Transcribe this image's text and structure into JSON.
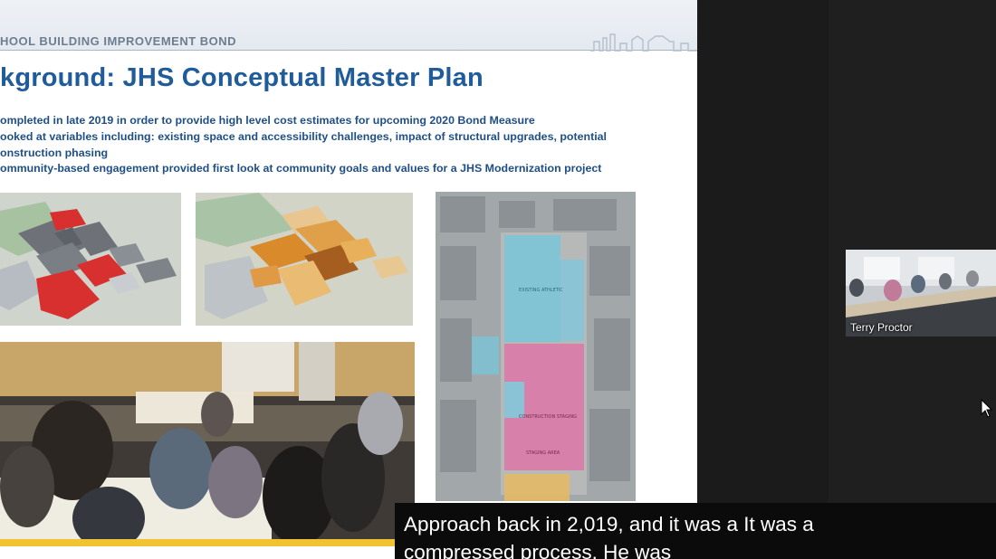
{
  "slide": {
    "band_title": "HOOL BUILDING IMPROVEMENT BOND",
    "title": "kground:  JHS Conceptual Master Plan",
    "bullets": [
      "ompleted in late 2019 in order to provide high level cost estimates for upcoming 2020 Bond Measure",
      "ooked at variables including:  existing space and accessibility challenges, impact of structural upgrades, potential",
      "onstruction phasing",
      "ommunity-based engagement provided first look at community goals and values for a JHS Modernization project"
    ],
    "images": [
      {
        "name": "red-building-massing-diagram"
      },
      {
        "name": "orange-building-massing-diagram"
      },
      {
        "name": "aerial-site-plan-map"
      },
      {
        "name": "community-meeting-photo"
      }
    ]
  },
  "captions": {
    "line1": "Approach back in 2,019, and it was a It was a",
    "line2": "compressed process. He was"
  },
  "participant": {
    "name": "Terry Proctor"
  }
}
